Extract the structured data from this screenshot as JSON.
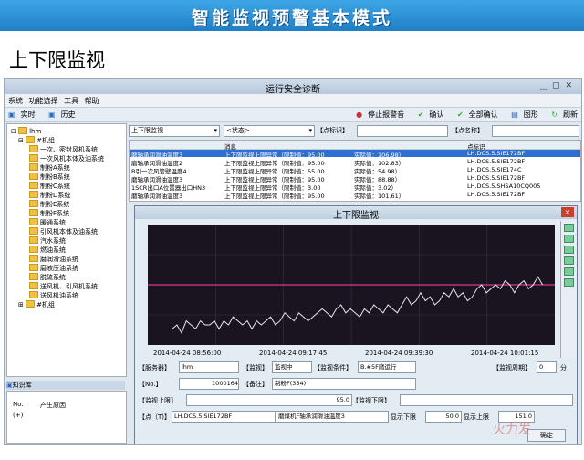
{
  "banner": {
    "title": "智能监视预警基本模式"
  },
  "slide": {
    "title": "上下限监视"
  },
  "window": {
    "title": "运行安全诊断"
  },
  "menu": [
    "系统",
    "功能选择",
    "工具",
    "帮助"
  ],
  "toolbar": {
    "realtime": "实时",
    "history": "历史",
    "stop_alarm": "停止报警音",
    "confirm": "确认",
    "confirm_all": "全部确认",
    "chart": "图形",
    "refresh": "刷新"
  },
  "tree": {
    "root": "lhm",
    "unit": "#机组",
    "items": [
      "一次、密封风机系统",
      "一次风机本体及油系统",
      "制粉A系统",
      "制粉B系统",
      "制粉C系统",
      "制粉D系统",
      "制粉E系统",
      "制粉F系统",
      "暖通系统",
      "引风机本体及油系统",
      "汽水系统",
      "燃油系统",
      "磨润滑油系统",
      "磨液压油系统",
      "脱硫系统",
      "送风机、引风机系统",
      "送风机油系统"
    ],
    "unit2": "#机组"
  },
  "knowledge": {
    "tab": "知识库",
    "col_no": "No.",
    "col_cause": "产生原因",
    "row1": "(+)"
  },
  "filters": {
    "type": "上下限监视",
    "state": "<状态>",
    "point_tag_label": "【点标识】",
    "point_name_label": "【点名称】"
  },
  "alarm_table": {
    "col_msg": "消息",
    "col_tag": "点标识",
    "rows": [
      {
        "name": "磨轴承润滑油温度3",
        "msg": "上下限监视上限异常（限制值：95.00",
        "value": "实际值：106.98）",
        "tag": "LH.DCS.5.SIE172BF"
      },
      {
        "name": "磨轴承润滑油温度2",
        "msg": "上下限监视上限异常（限制值：95.00",
        "value": "实际值：102.83）",
        "tag": "LH.DCS.5.SIE172BF"
      },
      {
        "name": "B引一次风管壁温度4",
        "msg": "上下限监视上限异常（限制值：55.00",
        "value": "实际值：54.98）",
        "tag": "LH.DCS.5.SIE174C"
      },
      {
        "name": "磨轴承润滑油温度3",
        "msg": "上下限监视上限异常（限制值：95.00",
        "value": "实际值：88.88）",
        "tag": "LH.DCS.5.SIE172BF"
      },
      {
        "name": "1SCR出口A位置器出口HN3",
        "msg": "上下限监视上限异常（限制值：3.00",
        "value": "实际值：3.02）",
        "tag": "LH.DCS.5.SHSA10CQ005"
      },
      {
        "name": "磨轴承润滑油温度3",
        "msg": "上下限监视上限异常（限制值：95.00",
        "value": "实际值：101.61）",
        "tag": "LH.DCS.5.SIE172BF"
      }
    ]
  },
  "popup": {
    "title": "上下限监视",
    "close": "×",
    "x_labels": [
      "2014-04-24 08:56:00",
      "2014-04-24 09:17:45",
      "2014-04-24 09:39:30",
      "2014-04-24 10:01:15"
    ],
    "server_label": "【服务器】",
    "server_value": "lhm",
    "state_label": "【监视】",
    "state_value": "监视中",
    "cond_label": "【监视条件】",
    "cond_value": "B.#5F磨运行",
    "cycle_label": "【监视周期】",
    "cycle_value": "0",
    "cycle_unit": "分",
    "no_label": "【No.】",
    "no_value": "1000164",
    "note_label": "【备注】",
    "note_value": "制粉F(354)",
    "upper_label": "【监视上限】",
    "upper_value": "95.0",
    "lower_label": "【监视下限】",
    "point_label": "【点（T)】",
    "point_value": "LH.DCS.5.SIE172BF",
    "point_name": "磨煤机F轴承润滑油温度3",
    "disp_lower_label": "显示下限",
    "disp_lower_value": "50.0",
    "disp_upper_label": "显示上限",
    "disp_upper_value": "151.0",
    "ok_button": "确定"
  },
  "watermark": "火力发",
  "colors": {
    "banner": "#2a8fd8",
    "plot_bg": "#1a1420",
    "limit_line": "#c0307a",
    "trend": "#e8e8e8"
  },
  "chart_data": {
    "type": "line",
    "series": [
      {
        "values": [
          84,
          85,
          83,
          86,
          85,
          84,
          86,
          85,
          85,
          86,
          84,
          86,
          85,
          87,
          86,
          85,
          86,
          84,
          86,
          85,
          86,
          87,
          85,
          86,
          88,
          87,
          86,
          88,
          87,
          86,
          87,
          88,
          89,
          88,
          87,
          89,
          90,
          88,
          89,
          88,
          87,
          89,
          88,
          90,
          89,
          88,
          90,
          89,
          88,
          90,
          92,
          90,
          91,
          93,
          91,
          92,
          90,
          91,
          93,
          92,
          94,
          92,
          93,
          91,
          92,
          94,
          95,
          93,
          94,
          95,
          94,
          96,
          95,
          93,
          95,
          96,
          94,
          95,
          97,
          95
        ]
      }
    ],
    "upper_limit": 95,
    "ylim": [
      80,
      110
    ]
  }
}
